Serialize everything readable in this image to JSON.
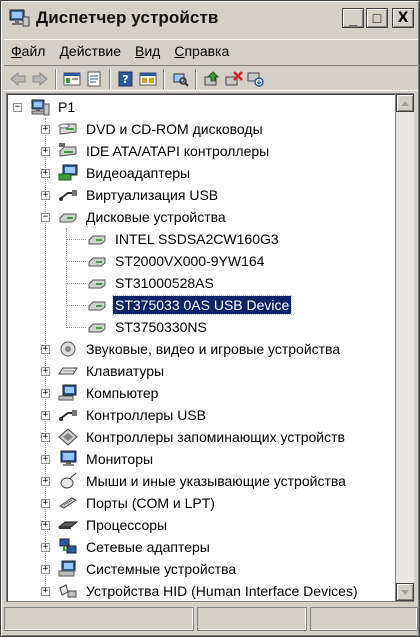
{
  "window": {
    "title": "Диспетчер устройств"
  },
  "titlebar_buttons": {
    "minimize": "_",
    "maximize": "□",
    "close": "X"
  },
  "menu": [
    {
      "label": "Файл",
      "accel": "Ф",
      "rest": "айл"
    },
    {
      "label": "Действие",
      "accel": "Д",
      "rest": "ействие"
    },
    {
      "label": "Вид",
      "accel": "В",
      "rest": "ид"
    },
    {
      "label": "Справка",
      "accel": "С",
      "rest": "правка"
    }
  ],
  "toolbar": [
    "back-arrow-icon",
    "forward-arrow-icon",
    "console-tree-icon",
    "properties-icon",
    "help-icon",
    "view-icon",
    "scan-hardware-icon",
    "update-driver-icon",
    "uninstall-icon",
    "disable-icon"
  ],
  "tree": {
    "root": "P1",
    "categories": [
      {
        "label": "DVD и CD-ROM дисководы",
        "icon": "dvd-drive-icon"
      },
      {
        "label": "IDE ATA/ATAPI контроллеры",
        "icon": "ide-controller-icon"
      },
      {
        "label": "Видеоадаптеры",
        "icon": "display-adapter-icon"
      },
      {
        "label": "Виртуализация USB",
        "icon": "usb-virtualization-icon"
      },
      {
        "label": "Дисковые устройства",
        "icon": "disk-drive-icon",
        "expanded": true,
        "children": [
          "INTEL SSDSA2CW160G3",
          "ST2000VX000-9YW164",
          "ST31000528AS",
          "ST375033 0AS USB Device",
          "ST3750330NS"
        ],
        "selected_child": 3
      },
      {
        "label": "Звуковые, видео и игровые устройства",
        "icon": "sound-icon"
      },
      {
        "label": "Клавиатуры",
        "icon": "keyboard-icon"
      },
      {
        "label": "Компьютер",
        "icon": "computer-icon"
      },
      {
        "label": "Контроллеры USB",
        "icon": "usb-controller-icon"
      },
      {
        "label": "Контроллеры запоминающих устройств",
        "icon": "storage-controller-icon"
      },
      {
        "label": "Мониторы",
        "icon": "monitor-icon"
      },
      {
        "label": "Мыши и иные указывающие устройства",
        "icon": "mouse-icon"
      },
      {
        "label": "Порты (COM и LPT)",
        "icon": "port-icon"
      },
      {
        "label": "Процессоры",
        "icon": "processor-icon"
      },
      {
        "label": "Сетевые адаптеры",
        "icon": "network-adapter-icon"
      },
      {
        "label": "Системные устройства",
        "icon": "system-device-icon"
      },
      {
        "label": "Устройства HID (Human Interface Devices)",
        "icon": "hid-icon"
      }
    ]
  },
  "colors": {
    "selection": "#0a246a",
    "window_face": "#d4d0c8"
  }
}
